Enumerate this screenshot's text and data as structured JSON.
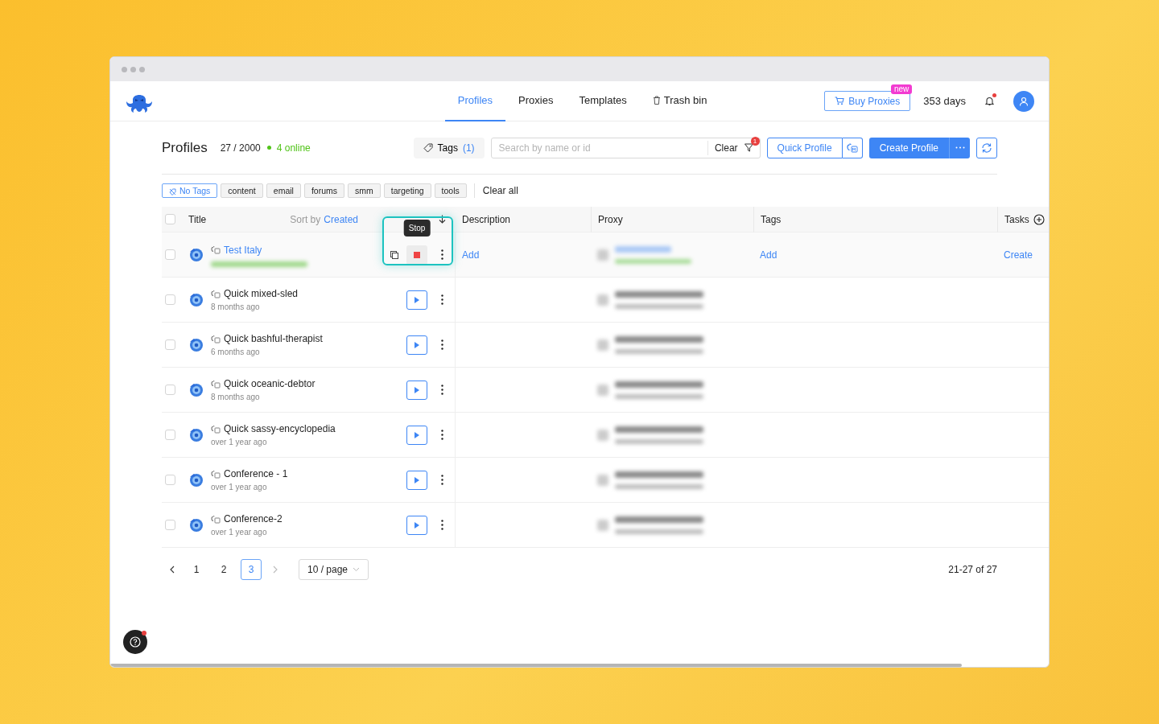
{
  "nav": {
    "tabs": [
      {
        "label": "Profiles",
        "selected": true,
        "kind": "plain"
      },
      {
        "label": "Proxies",
        "selected": false,
        "kind": "plain"
      },
      {
        "label": "Templates",
        "selected": false,
        "kind": "plain"
      },
      {
        "label": "Trash bin",
        "selected": false,
        "kind": "trash"
      }
    ],
    "buy_proxies": {
      "label": "Buy Proxies",
      "badge": "new"
    },
    "subscription": "353 days",
    "has_notification": true
  },
  "toolbar": {
    "title": "Profiles",
    "count": "27 / 2000",
    "online": "4 online",
    "tags_button": {
      "label": "Tags",
      "count": "(1)"
    },
    "search": {
      "placeholder": "Search by name or id"
    },
    "clear": "Clear",
    "filter_badge": "1",
    "quick_profile": "Quick Profile",
    "create_profile": "Create Profile"
  },
  "tag_filters": [
    {
      "label": "No Tags",
      "selected": true
    },
    {
      "label": "content",
      "selected": false
    },
    {
      "label": "email",
      "selected": false
    },
    {
      "label": "forums",
      "selected": false
    },
    {
      "label": "smm",
      "selected": false
    },
    {
      "label": "targeting",
      "selected": false
    },
    {
      "label": "tools",
      "selected": false
    }
  ],
  "clear_all": "Clear all",
  "table": {
    "columns": {
      "title": "Title",
      "sort_prefix": "Sort by",
      "sort_field": "Created",
      "description": "Description",
      "proxy": "Proxy",
      "tags": "Tags",
      "tasks": "Tasks"
    },
    "select_all_checked": false,
    "rows": [
      {
        "title": "Test Italy",
        "checked": false,
        "running": true,
        "hovered": true,
        "tooltip": "Stop",
        "description": "Add",
        "tags": "Add",
        "tasks": "Create"
      },
      {
        "title": "Quick mixed-sled",
        "subtitle": "8 months ago",
        "checked": false,
        "running": false,
        "hovered": false
      },
      {
        "title": "Quick bashful-therapist",
        "subtitle": "6 months ago",
        "checked": false,
        "running": false,
        "hovered": false
      },
      {
        "title": "Quick oceanic-debtor",
        "subtitle": "8 months ago",
        "checked": false,
        "running": false,
        "hovered": false
      },
      {
        "title": "Quick sassy-encyclopedia",
        "subtitle": "over 1 year ago",
        "checked": false,
        "running": false,
        "hovered": false
      },
      {
        "title": "Conference - 1",
        "subtitle": "over 1 year ago",
        "checked": false,
        "running": false,
        "hovered": false
      },
      {
        "title": "Conference-2",
        "subtitle": "over 1 year ago",
        "checked": false,
        "running": false,
        "hovered": false
      }
    ]
  },
  "pagination": {
    "prev_disabled": false,
    "next_disabled": true,
    "pages": [
      {
        "label": "1",
        "selected": false
      },
      {
        "label": "2",
        "selected": false
      },
      {
        "label": "3",
        "selected": true
      }
    ],
    "page_size": "10 / page",
    "range": "21-27 of 27"
  }
}
